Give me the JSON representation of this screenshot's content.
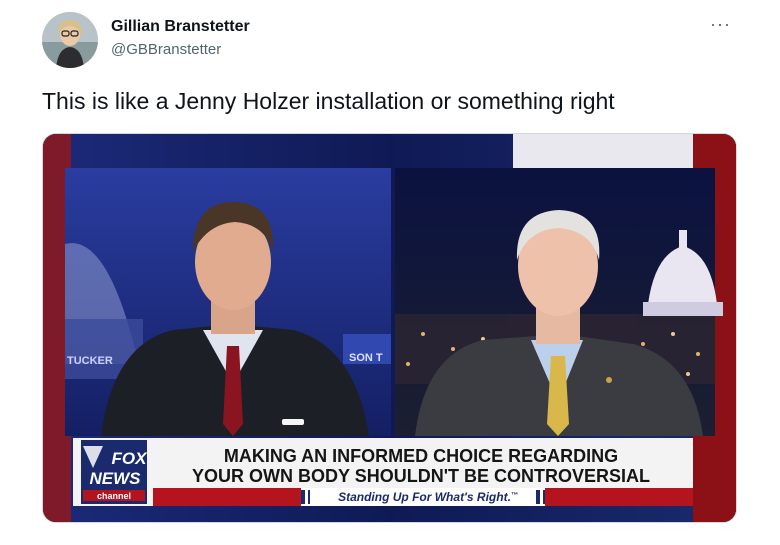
{
  "author": {
    "name": "Gillian Branstetter",
    "handle": "@GBBranstetter",
    "avatar_icon": "user-avatar"
  },
  "more_label": "···",
  "tweet": {
    "text": "This is like a Jenny Holzer installation or something right"
  },
  "media": {
    "chyron": {
      "line1": "MAKING AN INFORMED CHOICE REGARDING",
      "line2": "YOUR OWN BODY SHOULDN'T BE CONTROVERSIAL",
      "tagline": "Standing Up For What's Right.",
      "tm": "™"
    },
    "logo": {
      "line1": "FOX",
      "line2": "NEWS",
      "line3": "channel"
    },
    "set_text_left": "TUCKER",
    "set_text_right": "SON T",
    "colors": {
      "navy": "#1a2a6c",
      "red": "#b3141e",
      "chyron_bg": "#f3f3f3"
    }
  }
}
